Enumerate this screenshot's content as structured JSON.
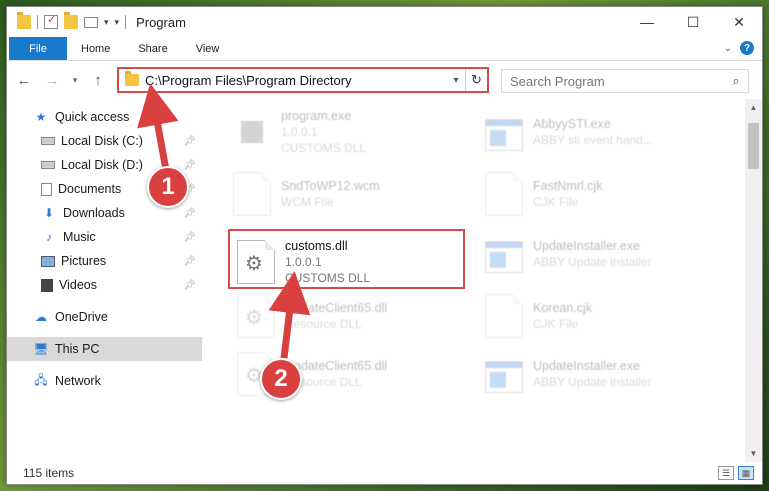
{
  "window": {
    "title": "Program",
    "controls": {
      "minimize": "—",
      "maximize": "☐",
      "close": "✕"
    }
  },
  "ribbon": {
    "tabs": [
      {
        "label": "File",
        "active": true
      },
      {
        "label": "Home"
      },
      {
        "label": "Share"
      },
      {
        "label": "View"
      }
    ],
    "help": "?"
  },
  "navigation": {
    "address": "C:\\Program Files\\Program Directory",
    "search_placeholder": "Search Program",
    "back": "←",
    "forward": "→",
    "up": "↑",
    "refresh": "↻"
  },
  "sidebar": {
    "items": [
      {
        "label": "Quick access",
        "icon": "star-icon",
        "pinned": false
      },
      {
        "label": "Local Disk (C:)",
        "icon": "drive-icon",
        "pinned": true
      },
      {
        "label": "Local Disk (D:)",
        "icon": "drive-icon",
        "pinned": true
      },
      {
        "label": "Documents",
        "icon": "documents-icon",
        "pinned": true
      },
      {
        "label": "Downloads",
        "icon": "download-icon",
        "pinned": true
      },
      {
        "label": "Music",
        "icon": "music-icon",
        "pinned": true
      },
      {
        "label": "Pictures",
        "icon": "pictures-icon",
        "pinned": true
      },
      {
        "label": "Videos",
        "icon": "videos-icon",
        "pinned": true
      },
      {
        "label": "OneDrive",
        "icon": "cloud-icon",
        "pinned": false
      },
      {
        "label": "This PC",
        "icon": "computer-icon",
        "pinned": false,
        "selected": true
      },
      {
        "label": "Network",
        "icon": "network-icon",
        "pinned": false
      }
    ]
  },
  "files": [
    {
      "name": "program.exe",
      "line2": "1.0.0.1",
      "line3": "CUSTOMS DLL",
      "type": "exe",
      "faded": true
    },
    {
      "name": "AbbyySTI.exe",
      "line2": "ABBY sti event hand...",
      "line3": "",
      "type": "app",
      "faded": true
    },
    {
      "name": "SndToWP12.wcm",
      "line2": "WCM File",
      "line3": "",
      "type": "doc",
      "faded": true
    },
    {
      "name": "FastNmrl.cjk",
      "line2": "CJK File",
      "line3": "",
      "type": "doc",
      "faded": true
    },
    {
      "name": "customs.dll",
      "line2": "1.0.0.1",
      "line3": "CUSTOMS DLL",
      "type": "dll",
      "faded": false
    },
    {
      "name": "UpdateInstaller.exe",
      "line2": "ABBY Update installer",
      "line3": "",
      "type": "app",
      "faded": true
    },
    {
      "name": "UpdateClient65.dll",
      "line2": "Resource DLL",
      "line3": "",
      "type": "dll",
      "faded": true
    },
    {
      "name": "Korean.cjk",
      "line2": "CJK File",
      "line3": "",
      "type": "doc",
      "faded": true
    },
    {
      "name": "UpdateClient65.dll",
      "line2": "Resource DLL",
      "line3": "",
      "type": "dll",
      "faded": true
    },
    {
      "name": "UpdateInstaller.exe",
      "line2": "ABBY Update installer",
      "line3": "",
      "type": "app",
      "faded": true
    }
  ],
  "status": {
    "count": "115 items"
  },
  "callouts": {
    "one": "1",
    "two": "2"
  },
  "colors": {
    "accent": "#1979ca",
    "highlight": "#d94a4a"
  }
}
